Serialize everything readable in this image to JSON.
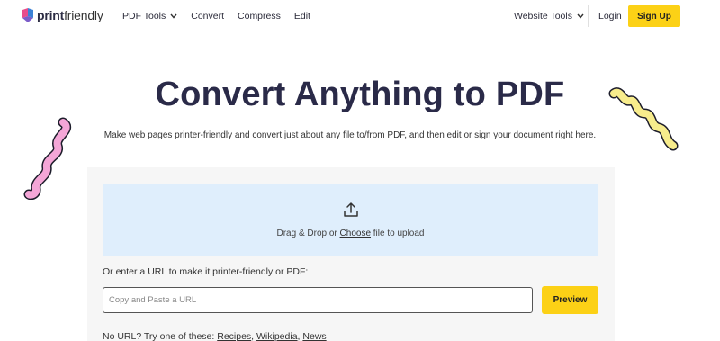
{
  "header": {
    "logo": {
      "bold": "print",
      "light": "friendly"
    },
    "nav_left": [
      {
        "label": "PDF Tools",
        "dropdown": true
      },
      {
        "label": "Convert"
      },
      {
        "label": "Compress"
      },
      {
        "label": "Edit"
      }
    ],
    "nav_right": {
      "label": "Website Tools",
      "dropdown": true
    },
    "login_label": "Login",
    "signup_label": "Sign Up"
  },
  "hero": {
    "title": "Convert Anything to PDF",
    "subtitle": "Make web pages printer-friendly and convert just about any file to/from PDF, and then edit or sign your document right here."
  },
  "dropzone": {
    "text_before": "Drag & Drop or ",
    "link": "Choose",
    "text_after": " file to upload"
  },
  "url_form": {
    "label": "Or enter a URL to make it printer-friendly or PDF:",
    "placeholder": "Copy and Paste a URL",
    "value": "",
    "button": "Preview"
  },
  "samples": {
    "prefix": "No URL? Try one of these: ",
    "links": [
      "Recipes",
      "Wikipedia",
      "News"
    ]
  },
  "colors": {
    "accent": "#fcd116",
    "dropzone_bg": "#dfeefc",
    "title": "#2a2a48",
    "squiggle_pink": "#f4a6d7",
    "squiggle_yellow": "#f7ec8c"
  }
}
